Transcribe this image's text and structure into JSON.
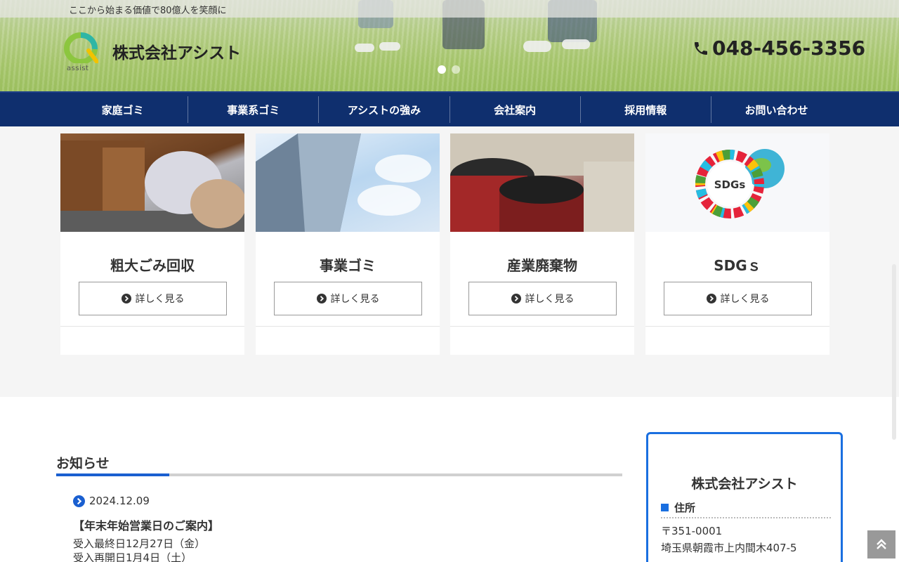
{
  "header": {
    "tagline": "ここから始まる価値で80億人を笑顔に",
    "logo_text": "assist",
    "company_name": "株式会社アシスト",
    "phone": "048-456-3356",
    "slides": 2
  },
  "nav": {
    "items": [
      "家庭ゴミ",
      "事業系ゴミ",
      "アシストの強み",
      "会社案内",
      "採用情報",
      "お問い合わせ"
    ]
  },
  "services": [
    {
      "title": "粗大ごみ回収",
      "button": "詳しく見る",
      "image": "furniture-photo"
    },
    {
      "title": "事業ゴミ",
      "button": "詳しく見る",
      "image": "building-photo"
    },
    {
      "title": "産業廃棄物",
      "button": "詳しく見る",
      "image": "waste-photo"
    },
    {
      "title": "SDGｓ",
      "button": "詳しく見る",
      "image": "sdgs-photo"
    }
  ],
  "news": {
    "title": "お知らせ",
    "items": [
      {
        "date": "2024.12.09",
        "headline": "【年末年始営業日のご案内】",
        "lines": [
          "受入最終日12月27日（金）",
          "受入再開日1月4日（土）"
        ]
      }
    ]
  },
  "company_box": {
    "name": "株式会社アシスト",
    "address_label": "住所",
    "postal": "〒351-0001",
    "address": "埼玉県朝霞市上内間木407-5"
  },
  "sdgs_label": "SDGs",
  "colors": {
    "nav_bg": "#0f2f6e",
    "accent_blue": "#1a5fd0",
    "box_border": "#1a6fe0"
  }
}
